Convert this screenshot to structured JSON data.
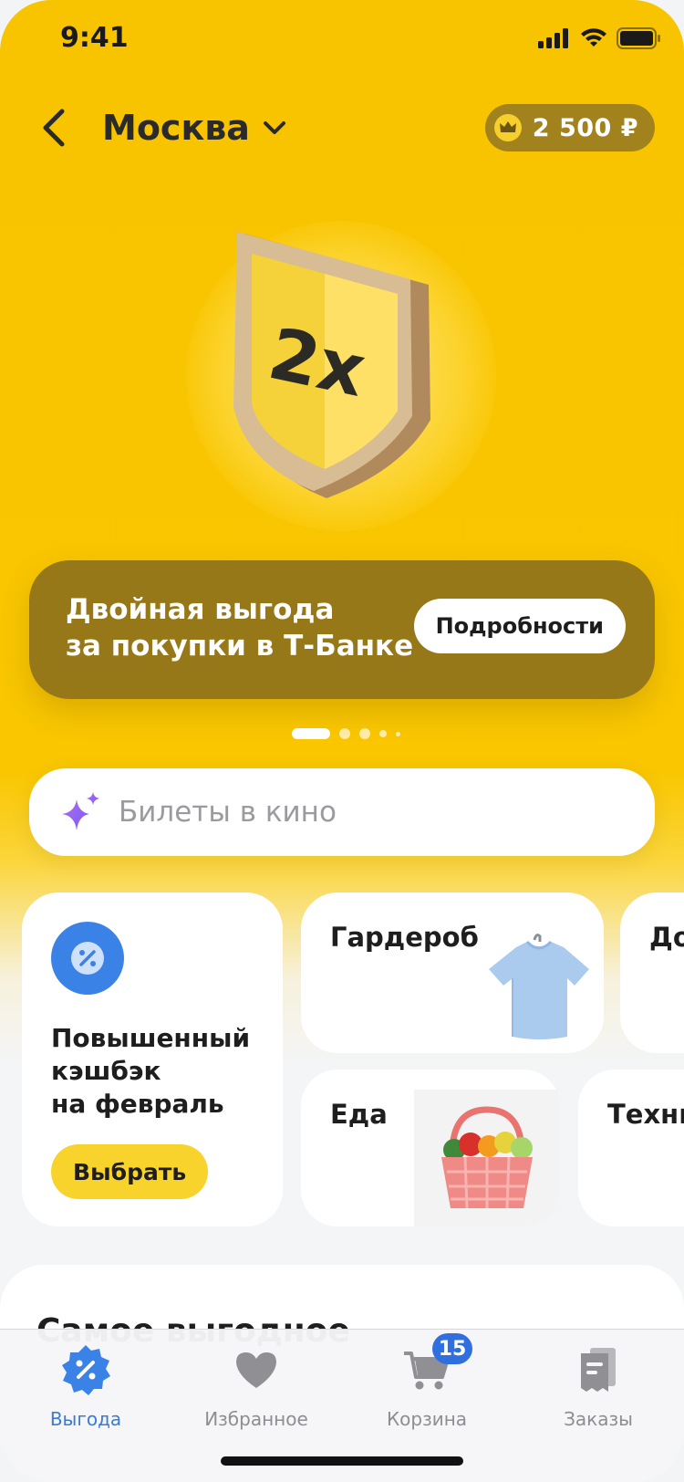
{
  "status_bar": {
    "time": "9:41"
  },
  "header": {
    "city": "Москва",
    "balance": "2 500 ₽"
  },
  "hero": {
    "badge_text": "2x"
  },
  "promo": {
    "title_line1": "Двойная выгода",
    "title_line2": "за покупки в Т-Банке",
    "button_label": "Подробности",
    "pages_total": 5,
    "page_active": 1
  },
  "search": {
    "placeholder": "Билеты в кино"
  },
  "cashback_card": {
    "title_line1": "Повышенный",
    "title_line2": "кэшбэк",
    "title_line3": "на февраль",
    "button_label": "Выбрать"
  },
  "categories": {
    "wardrobe": "Гардероб",
    "home": "До",
    "food": "Еда",
    "tech": "Техни"
  },
  "best_section": {
    "title": "Самое выгодное"
  },
  "tab_bar": {
    "tabs": [
      {
        "label": "Выгода",
        "active": true
      },
      {
        "label": "Избранное"
      },
      {
        "label": "Корзина",
        "badge": "15"
      },
      {
        "label": "Заказы"
      }
    ]
  },
  "colors": {
    "brand_yellow": "#f8c400",
    "promo_brown": "#977818",
    "active_blue": "#3a7bd5"
  }
}
